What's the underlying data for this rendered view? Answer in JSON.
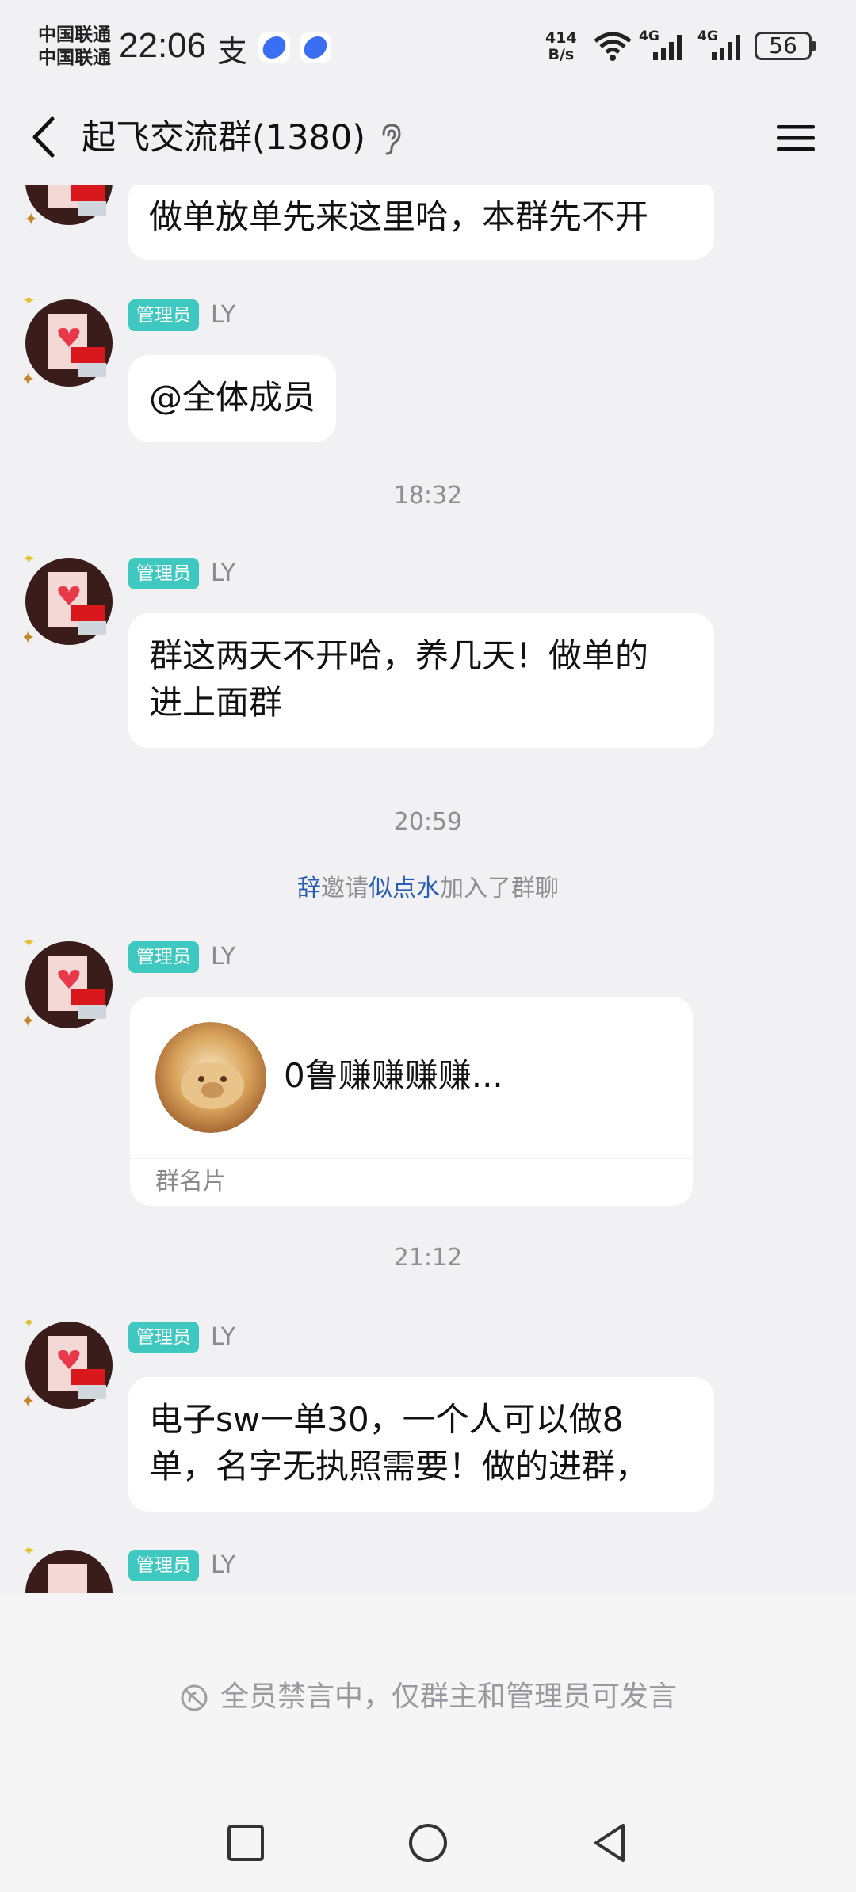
{
  "status_bar": {
    "carrier_1": "中国联通",
    "carrier_2": "中国联通",
    "time": "22:06",
    "alipay_glyph": "支",
    "speed_value": "414",
    "speed_unit": "B/s",
    "net_1": "4G",
    "net_2": "4G",
    "battery": "56"
  },
  "header": {
    "title": "起飞交流群(1380)"
  },
  "messages": {
    "m1": {
      "text": "做单放单先来这里哈，本群先不开"
    },
    "m2": {
      "role": "管理员",
      "nick": "LY",
      "text": "@全体成员"
    },
    "t1": "18:32",
    "m3": {
      "role": "管理员",
      "nick": "LY",
      "line1": "群这两天不开哈，养几天！做单的",
      "line2": "进上面群"
    },
    "t2": "20:59",
    "sys": {
      "inviter": "辞",
      "verb": "邀请",
      "invitee": "似点水",
      "suffix": "加入了群聊"
    },
    "m4": {
      "role": "管理员",
      "nick": "LY",
      "card_name": "0鲁赚赚赚赚...",
      "card_type": "群名片"
    },
    "t3": "21:12",
    "m5": {
      "role": "管理员",
      "nick": "LY",
      "line1": "电子sw一单30，一个人可以做8",
      "line2": "单，名字无执照需要！做的进群，"
    },
    "m6": {
      "role": "管理员",
      "nick": "LY"
    }
  },
  "bottom": {
    "muted_text": "全员禁言中，仅群主和管理员可发言"
  },
  "colors": {
    "admin_badge": "#3fc8bf",
    "link": "#2b5db2",
    "background": "#f1f1f3"
  }
}
